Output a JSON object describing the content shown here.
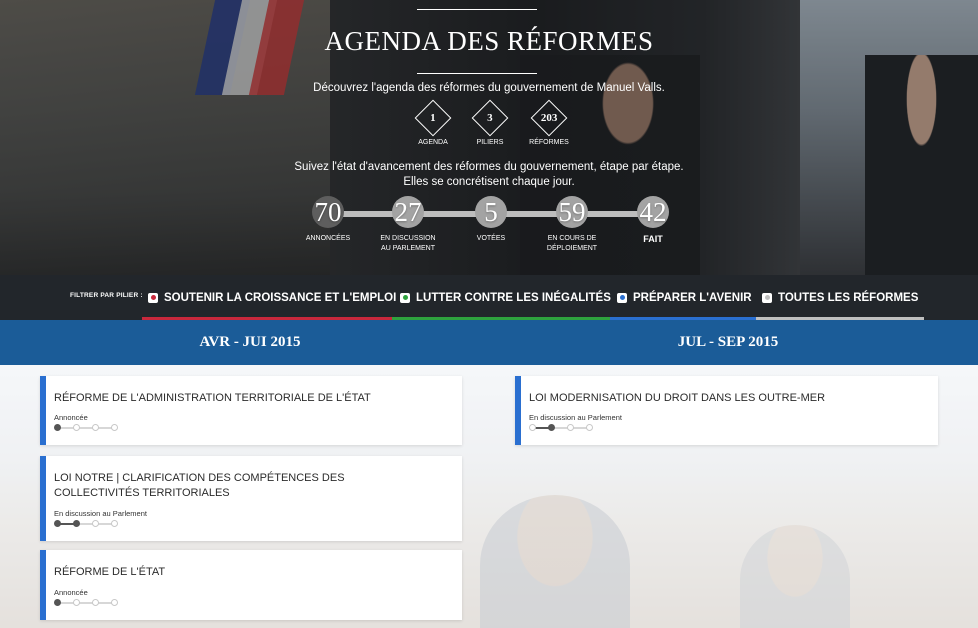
{
  "hero": {
    "title": "AGENDA DES RÉFORMES",
    "intro": "Découvrez l'agenda des réformes du gouvernement de Manuel Valls.",
    "stats": [
      {
        "value": "1",
        "label": "AGENDA"
      },
      {
        "value": "3",
        "label": "PILIERS"
      },
      {
        "value": "203",
        "label": "RÉFORMES"
      }
    ],
    "follow_line1": "Suivez l'état d'avancement des réformes du gouvernement, étape par étape.",
    "follow_line2": "Elles se concrétisent chaque jour.",
    "stages": [
      {
        "value": "70",
        "label": "ANNONCÉES",
        "label2": ""
      },
      {
        "value": "27",
        "label": "EN DISCUSSION",
        "label2": "AU PARLEMENT"
      },
      {
        "value": "5",
        "label": "VOTÉES",
        "label2": ""
      },
      {
        "value": "59",
        "label": "EN COURS DE",
        "label2": "DÉPLOIEMENT"
      },
      {
        "value": "42",
        "label": "FAIT",
        "label2": ""
      }
    ]
  },
  "filters": {
    "label": "FILTRER PAR PILIER :",
    "items": [
      {
        "label": "SOUTENIR LA CROISSANCE ET L'EMPLOI",
        "color": "#c8283c"
      },
      {
        "label": "LUTTER CONTRE LES INÉGALITÉS",
        "color": "#2ea23e"
      },
      {
        "label": "PRÉPARER L'AVENIR",
        "color": "#2a6fd0"
      },
      {
        "label": "TOUTES LES RÉFORMES",
        "color": "#bfbfbf"
      }
    ]
  },
  "periods": [
    "AVR - JUI 2015",
    "JUL - SEP 2015"
  ],
  "cards": [
    {
      "title": "RÉFORME DE L'ADMINISTRATION TERRITORIALE DE L'ÉTAT",
      "status": "Annoncée",
      "step": 1
    },
    {
      "title": "LOI NOTRE  | CLARIFICATION DES COMPÉTENCES DES COLLECTIVITÉS TERRITORIALES",
      "status": "En discussion au Parlement",
      "step": 2
    },
    {
      "title": "RÉFORME DE L'ÉTAT",
      "status": "Annoncée",
      "step": 1
    },
    {
      "title": "LOI MODERNISATION DU DROIT DANS LES OUTRE-MER",
      "status": "En discussion au Parlement",
      "step": 2
    }
  ],
  "colors": {
    "accent": "#2a6fd0",
    "period_bar": "#1b5c98",
    "filter_bar": "#22262b"
  }
}
